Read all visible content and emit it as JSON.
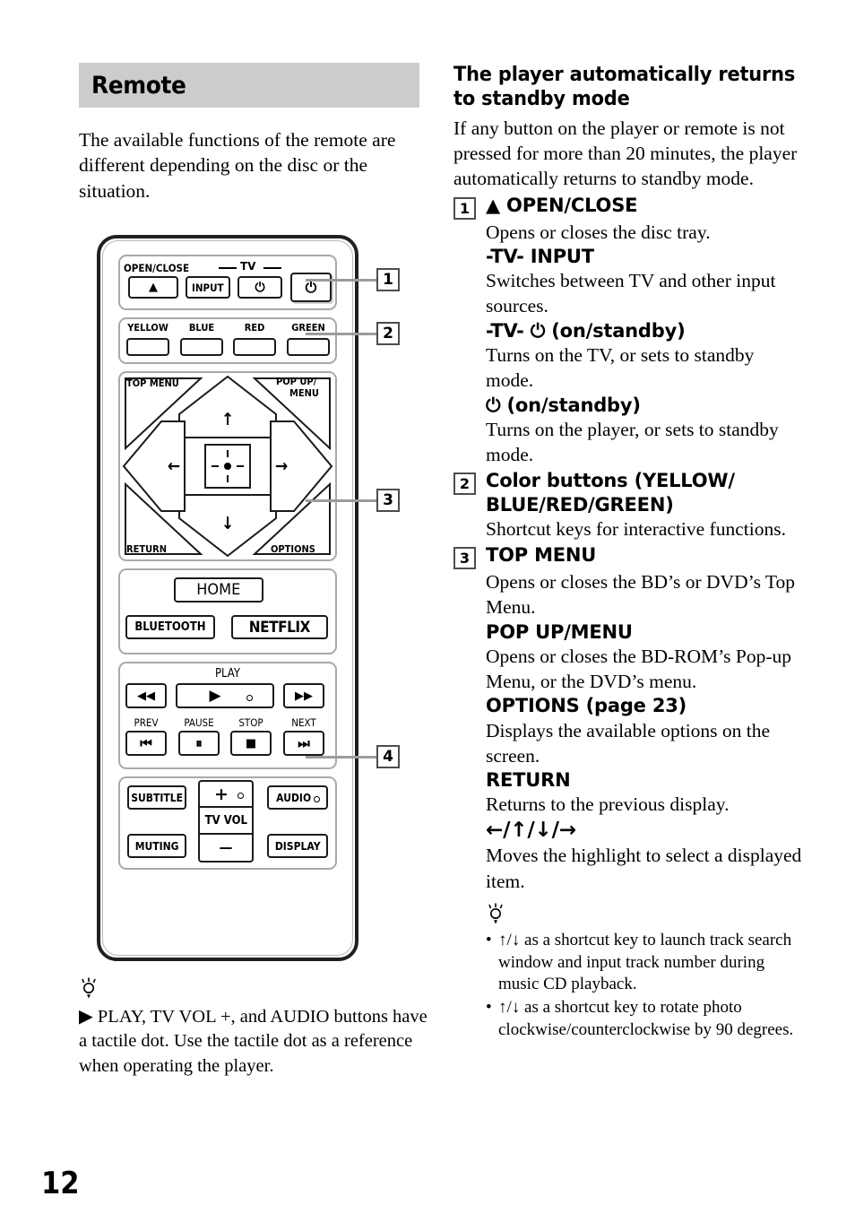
{
  "page_number": "12",
  "left": {
    "section_title": "Remote",
    "intro": "The available functions of the remote are different depending on the disc or the situation.",
    "tip": {
      "icon": "lightbulb-tip-icon",
      "text": "▶ PLAY, TV VOL +, and AUDIO buttons have a tactile dot. Use the tactile dot as a reference when operating the player."
    }
  },
  "remote": {
    "group1": {
      "open_close_label": "OPEN/CLOSE",
      "tv_label": "TV",
      "eject_icon": "▲",
      "input_button": "INPUT",
      "tv_power_icon": "⏻",
      "player_power_icon": "⏻"
    },
    "color_buttons": [
      "YELLOW",
      "BLUE",
      "RED",
      "GREEN"
    ],
    "dpad": {
      "top_menu": "TOP MENU",
      "pop_up_menu_line1": "POP UP/",
      "pop_up_menu_line2": "MENU",
      "return": "RETURN",
      "options": "OPTIONS",
      "up": "↑",
      "down": "↓",
      "left": "←",
      "right": "→",
      "enter": "enter-crosshair-icon"
    },
    "home": "HOME",
    "bluetooth": "BLUETOOTH",
    "netflix": "NETFLIX",
    "play_section": {
      "play_label": "PLAY",
      "rewind": "◀◀",
      "play": "▶",
      "forward": "▶▶",
      "prev_label": "PREV",
      "pause_label": "PAUSE",
      "stop_label": "STOP",
      "next_label": "NEXT",
      "prev": "⏮",
      "pause": "⏸",
      "stop": "■",
      "next": "⏭"
    },
    "bottom": {
      "subtitle": "SUBTITLE",
      "muting": "MUTING",
      "vol_plus": "+",
      "tv_vol": "TV VOL",
      "vol_minus": "—",
      "audio": "AUDIO",
      "display": "DISPLAY"
    },
    "callouts": [
      "1",
      "2",
      "3",
      "4"
    ]
  },
  "right": {
    "heading": "The player automatically returns to standby mode",
    "heading_body": "If any button on the player or remote is not pressed for more than 20 minutes, the player automatically returns to standby mode.",
    "entries": [
      {
        "num": "1",
        "title": "▲ OPEN/CLOSE",
        "body": "Opens or closes the disc tray.",
        "subs": [
          {
            "title": "-TV- INPUT",
            "body": "Switches between TV and other input sources."
          },
          {
            "title": "-TV- ⏻ (on/standby)",
            "body": "Turns on the TV, or sets to standby mode."
          },
          {
            "title": "⏻ (on/standby)",
            "body": "Turns on the player, or sets to standby mode."
          }
        ]
      },
      {
        "num": "2",
        "title": "Color buttons (YELLOW/ BLUE/RED/GREEN)",
        "body": "Shortcut keys for interactive functions.",
        "subs": []
      },
      {
        "num": "3",
        "title": "TOP MENU",
        "body": "Opens or closes the BD’s or DVD’s Top Menu.",
        "subs": [
          {
            "title": "POP UP/MENU",
            "body": "Opens or closes the BD-ROM’s Pop-up Menu, or the DVD’s menu."
          },
          {
            "title": "OPTIONS (page 23)",
            "body": "Displays the available options on the screen."
          },
          {
            "title": "RETURN",
            "body": "Returns to the previous display."
          },
          {
            "title": "←/↑/↓/→",
            "body": "Moves the highlight to select a displayed item."
          }
        ]
      }
    ],
    "tip": {
      "icon": "lightbulb-tip-icon",
      "bullets": [
        "↑/↓ as a shortcut key to launch track search window and input track number during music CD playback.",
        "↑/↓ as a shortcut key to rotate photo clockwise/counterclockwise by 90 degrees."
      ]
    }
  }
}
